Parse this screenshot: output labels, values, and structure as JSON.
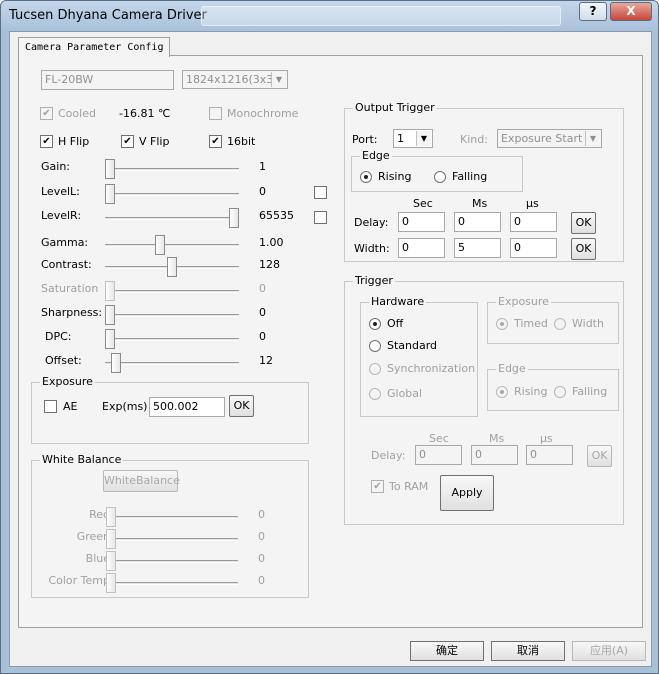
{
  "window": {
    "title": "Tucsen Dhyana Camera Driver",
    "help_label": "?",
    "close_label": "X"
  },
  "tab": {
    "label": "Camera Parameter Config"
  },
  "camera": {
    "model": "FL-20BW",
    "resolution": "1824x1216(3x3Bi"
  },
  "cooled": {
    "label": "Cooled",
    "temperature": "-16.81 ℃",
    "checked": true
  },
  "monochrome": {
    "label": "Monochrome"
  },
  "flags": {
    "hflip": "H Flip",
    "vflip": "V Flip",
    "bit16": "16bit",
    "check_mark": "✔"
  },
  "sliders": [
    {
      "label": "Gain:",
      "value": "1",
      "fraction": 0.0,
      "enabled": true
    },
    {
      "label": "LevelL:",
      "value": "0",
      "fraction": 0.0,
      "enabled": true
    },
    {
      "label": "LevelR:",
      "value": "65535",
      "fraction": 1.0,
      "enabled": true
    },
    {
      "label": "Gamma:",
      "value": "1.00",
      "fraction": 0.4,
      "enabled": true
    },
    {
      "label": "Contrast:",
      "value": "128",
      "fraction": 0.5,
      "enabled": true
    },
    {
      "label": "Saturation",
      "value": "0",
      "fraction": 0.0,
      "enabled": false
    },
    {
      "label": "Sharpness:",
      "value": "0",
      "fraction": 0.0,
      "enabled": true
    },
    {
      "label": "DPC:",
      "value": "0",
      "fraction": 0.0,
      "enabled": true
    },
    {
      "label": "Offset:",
      "value": "12",
      "fraction": 0.05,
      "enabled": true
    }
  ],
  "exposure": {
    "title": "Exposure",
    "ae_label": "AE",
    "exp_label": "Exp(ms)",
    "exp_value": "500.002",
    "ok_label": "OK"
  },
  "white_balance": {
    "title": "White Balance",
    "button_label": "WhiteBalance",
    "sliders": [
      {
        "label": "Red",
        "value": "0"
      },
      {
        "label": "Green",
        "value": "0"
      },
      {
        "label": "Blue",
        "value": "0"
      },
      {
        "label": "Color Temp",
        "value": "0"
      }
    ]
  },
  "output_trigger": {
    "title": "Output Trigger",
    "port_label": "Port:",
    "port_value": "1",
    "kind_label": "Kind:",
    "kind_value": "Exposure Start",
    "edge_title": "Edge",
    "rising": "Rising",
    "falling": "Falling",
    "col_sec": "Sec",
    "col_ms": "Ms",
    "col_us": "µs",
    "delay_label": "Delay:",
    "delay": [
      "0",
      "0",
      "0"
    ],
    "width_label": "Width:",
    "width": [
      "0",
      "5",
      "0"
    ],
    "ok_label": "OK"
  },
  "trigger": {
    "title": "Trigger",
    "hardware_title": "Hardware",
    "off": "Off",
    "standard": "Standard",
    "synchronization": "Synchronization",
    "global": "Global",
    "exposure_title": "Exposure",
    "timed": "Timed",
    "width": "Width",
    "edge_title": "Edge",
    "rising": "Rising",
    "falling": "Falling",
    "col_sec": "Sec",
    "col_ms": "Ms",
    "col_us": "µs",
    "delay_label": "Delay:",
    "delay": [
      "0",
      "0",
      "0"
    ],
    "ok_label": "OK",
    "to_ram": "To RAM",
    "apply_label": "Apply"
  },
  "footer": {
    "ok": "确定",
    "cancel": "取消",
    "apply": "应用(A)"
  }
}
